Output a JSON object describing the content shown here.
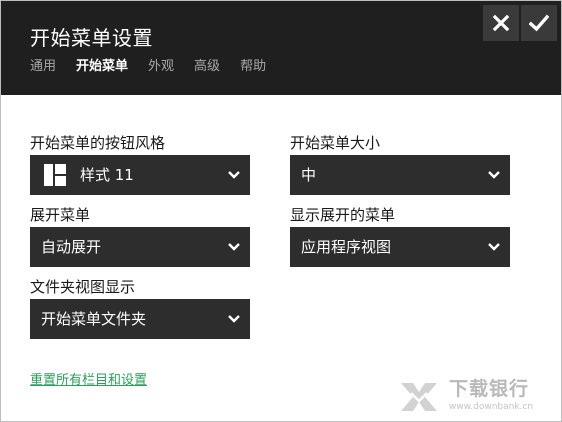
{
  "window": {
    "title": "开始菜单设置",
    "tabs": [
      {
        "label": "通用",
        "active": false
      },
      {
        "label": "开始菜单",
        "active": true
      },
      {
        "label": "外观",
        "active": false
      },
      {
        "label": "高级",
        "active": false
      },
      {
        "label": "帮助",
        "active": false
      }
    ],
    "close_icon": "close-x-icon",
    "confirm_icon": "checkmark-icon"
  },
  "settings": {
    "button_style": {
      "label": "开始菜单的按钮风格",
      "value": "样式 11",
      "icon": "tile-layout-icon"
    },
    "menu_size": {
      "label": "开始菜单大小",
      "value": "中"
    },
    "expand_menu": {
      "label": "展开菜单",
      "value": "自动展开"
    },
    "show_expanded": {
      "label": "显示展开的菜单",
      "value": "应用程序视图"
    },
    "folder_view": {
      "label": "文件夹视图显示",
      "value": "开始菜单文件夹"
    }
  },
  "footer": {
    "reset_link": "重置所有栏目和设置"
  },
  "watermark": {
    "text": "下载银行",
    "sub": "www.downbank.cn"
  },
  "colors": {
    "header_bg": "#1f1f1f",
    "dropdown_bg": "#2d2d2d",
    "link": "#2e9e5b"
  }
}
